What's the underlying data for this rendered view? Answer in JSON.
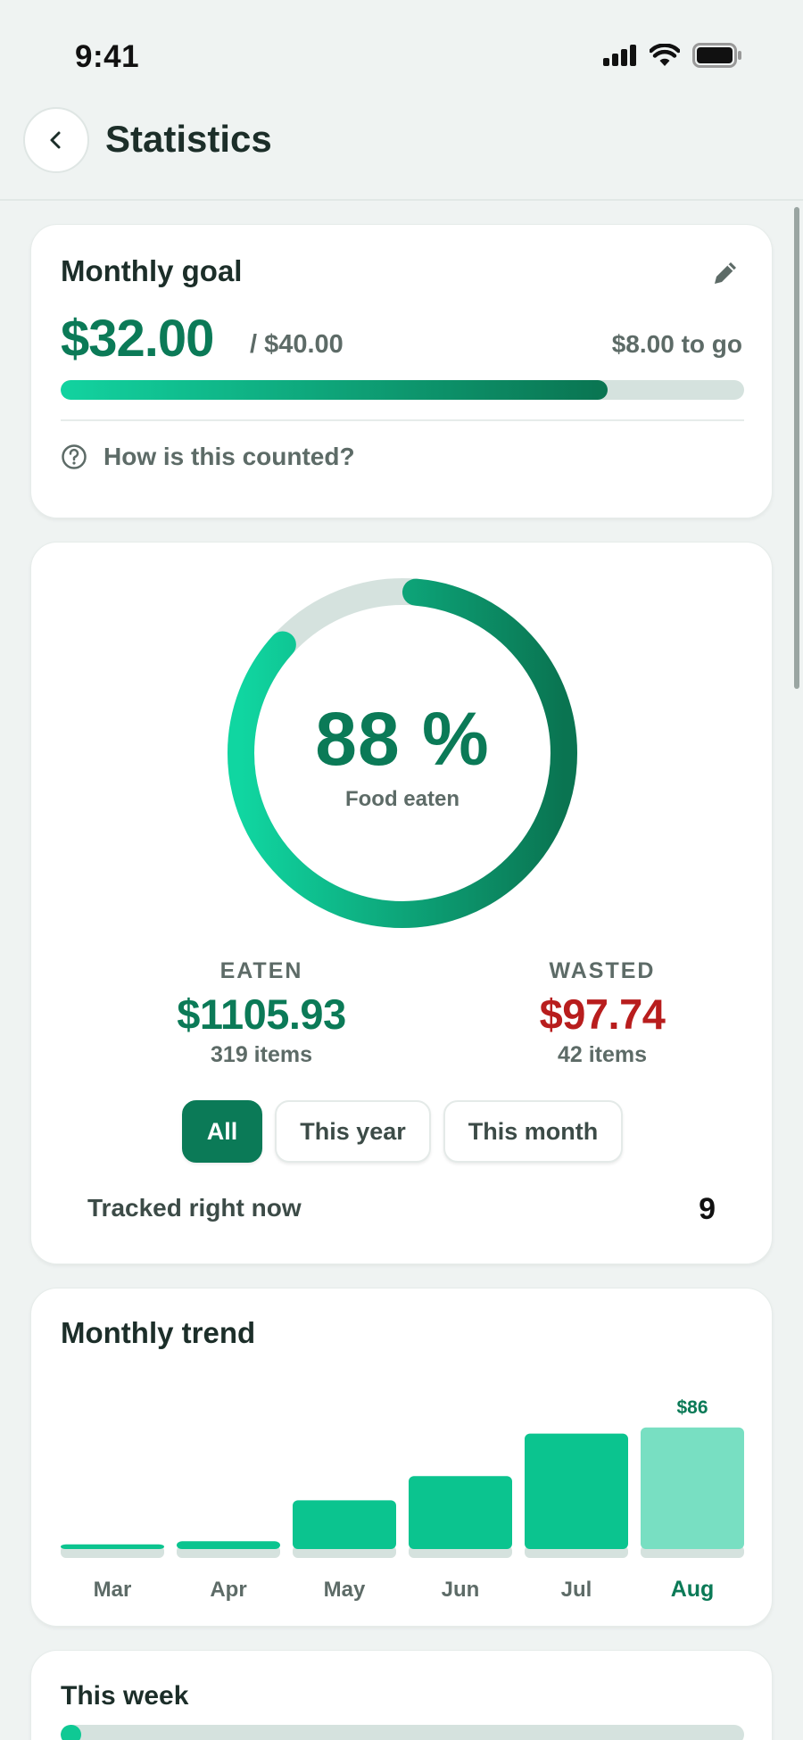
{
  "status_bar": {
    "time": "9:41"
  },
  "header": {
    "title": "Statistics"
  },
  "goal": {
    "title": "Monthly goal",
    "amount": "$32.00",
    "total": "/ $40.00",
    "to_go": "$8.00 to go",
    "progress_fraction": 0.8,
    "help_text": "How is this counted?"
  },
  "ratio": {
    "percent_text": "88 %",
    "percent_value": 88,
    "caption": "Food eaten",
    "eaten": {
      "label": "EATEN",
      "value": "$1105.93",
      "count": "319 items"
    },
    "wasted": {
      "label": "WASTED",
      "value": "$97.74",
      "count": "42 items"
    },
    "filters": [
      {
        "label": "All",
        "active": true
      },
      {
        "label": "This year",
        "active": false
      },
      {
        "label": "This month",
        "active": false
      }
    ],
    "tracked_label": "Tracked right now",
    "tracked_value": "9"
  },
  "trend": {
    "title": "Monthly trend"
  },
  "week": {
    "title": "This week",
    "progress_fraction": 0.03
  },
  "colors": {
    "accent": "#0b7a57",
    "bar": "#0bc48f",
    "bar_current": "#78dfc2",
    "bar_base": "#d5e2de",
    "wasted": "#b81d1d"
  },
  "chart_data": {
    "type": "bar",
    "categories": [
      "Mar",
      "Apr",
      "May",
      "Jun",
      "Jul",
      "Aug"
    ],
    "values": [
      9,
      11,
      38,
      54,
      82,
      86
    ],
    "data_labels": [
      "",
      "",
      "",
      "",
      "",
      "$86"
    ],
    "highlight_index": 5,
    "ylim": [
      0,
      100
    ]
  }
}
